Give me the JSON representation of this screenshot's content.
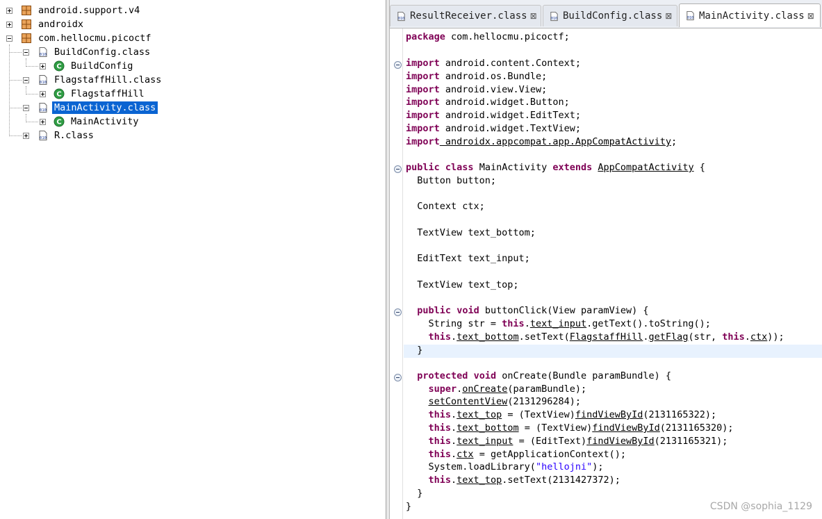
{
  "tree": {
    "items": [
      {
        "label": "android.support.v4",
        "type": "package",
        "expanded": false
      },
      {
        "label": "androidx",
        "type": "package",
        "expanded": false
      },
      {
        "label": "com.hellocmu.picoctf",
        "type": "package",
        "expanded": true
      },
      {
        "label": "BuildConfig.class",
        "type": "classfile",
        "expanded": true
      },
      {
        "label": "BuildConfig",
        "type": "class",
        "expanded": false
      },
      {
        "label": "FlagstaffHill.class",
        "type": "classfile",
        "expanded": true
      },
      {
        "label": "FlagstaffHill",
        "type": "class",
        "expanded": false
      },
      {
        "label": "MainActivity.class",
        "type": "classfile",
        "expanded": true,
        "selected": true
      },
      {
        "label": "MainActivity",
        "type": "class",
        "expanded": false
      },
      {
        "label": "R.class",
        "type": "classfile",
        "expanded": false
      }
    ]
  },
  "tabs": [
    {
      "label": "ResultReceiver.class",
      "close": "⊠"
    },
    {
      "label": "BuildConfig.class",
      "close": "⊠"
    },
    {
      "label": "MainActivity.class",
      "close": "⊠",
      "active": true
    }
  ],
  "code": {
    "package": "package",
    "package_name": " com.hellocmu.picoctf;",
    "import_kw": "import",
    "imports": [
      " android.content.Context;",
      " android.os.Bundle;",
      " android.view.View;",
      " android.widget.Button;",
      " android.widget.EditText;",
      " android.widget.TextView;",
      " androidx.appcompat.app.AppCompatActivity"
    ],
    "semicolon": ";",
    "public": "public",
    "class": "class",
    "class_name": " MainActivity ",
    "extends": "extends",
    "super_class": "AppCompatActivity",
    "open_brace": " {",
    "fields": [
      "  Button button;",
      "  Context ctx;",
      "  TextView text_bottom;",
      "  EditText text_input;",
      "  TextView text_top;"
    ],
    "void": "void",
    "method1_sig": " buttonClick(View paramView) {",
    "m1_l1_a": "    String str = ",
    "this": "this",
    "dot": ".",
    "text_input": "text_input",
    "m1_l1_b": ".getText().toString();",
    "text_bottom": "text_bottom",
    "m1_l2_a": ".setText(",
    "flagstaff": "FlagstaffHill",
    "getflag": "getFlag",
    "m1_l2_b": "(str, ",
    "ctx": "ctx",
    "m1_l2_c": "));",
    "close_inner": "  }",
    "protected": "protected",
    "method2_sig": " onCreate(Bundle paramBundle) {",
    "super": "super",
    "oncreate": "onCreate",
    "m2_l1_b": "(paramBundle);",
    "setcontentview": "setContentView",
    "m2_l2_b": "(2131296284);",
    "text_top": "text_top",
    "cast_textview": " = (TextView)",
    "cast_edittext": " = (EditText)",
    "findviewbyid": "findViewById",
    "id_top": "(2131165322);",
    "id_bottom": "(2131165320);",
    "id_input": "(2131165321);",
    "m2_ctx_b": " = getApplicationContext();",
    "loadlib_a": "    System.loadLibrary(",
    "loadlib_str": "\"hellojni\"",
    "loadlib_b": ");",
    "settext_top": ".setText(2131427372);",
    "close_outer": "}"
  },
  "watermark": "CSDN @sophia_1129"
}
